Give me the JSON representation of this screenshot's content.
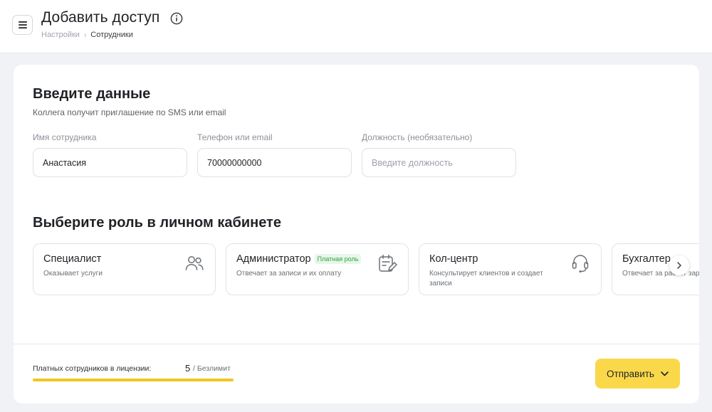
{
  "header": {
    "title": "Добавить доступ",
    "breadcrumb": [
      "Настройки",
      "Сотрудники"
    ]
  },
  "form": {
    "title": "Введите данные",
    "subtitle": "Коллега получит приглашение по SMS или email",
    "fields": [
      {
        "label": "Имя сотрудника",
        "value": "Анастасия",
        "placeholder": ""
      },
      {
        "label": "Телефон или email",
        "value": "70000000000",
        "placeholder": ""
      },
      {
        "label": "Должность (необязательно)",
        "value": "",
        "placeholder": "Введите должность"
      }
    ]
  },
  "roles": {
    "title": "Выберите роль в личном кабинете",
    "items": [
      {
        "name": "Специалист",
        "description": "Оказывает услуги",
        "badge": "",
        "icon": "users-icon"
      },
      {
        "name": "Администратор",
        "description": "Отвечает за записи и их оплату",
        "badge": "Платная роль",
        "icon": "calendar-edit-icon"
      },
      {
        "name": "Кол-центр",
        "description": "Консультирует клиентов и создает записи",
        "badge": "",
        "icon": "headset-icon"
      },
      {
        "name": "Бухгалтер",
        "description": "Отвечает за расчет зарплат",
        "badge": "",
        "icon": ""
      }
    ]
  },
  "footer": {
    "license_label": "Платных сотрудников в лицензии:",
    "license_count": "5",
    "license_limit": "/ Безлимит",
    "license_fill_percent": 100,
    "send_label": "Отправить"
  },
  "colors": {
    "accent": "#fad84a",
    "progress": "#f2c61f",
    "badge_bg": "#e7f7e9",
    "badge_text": "#2f9e44"
  }
}
